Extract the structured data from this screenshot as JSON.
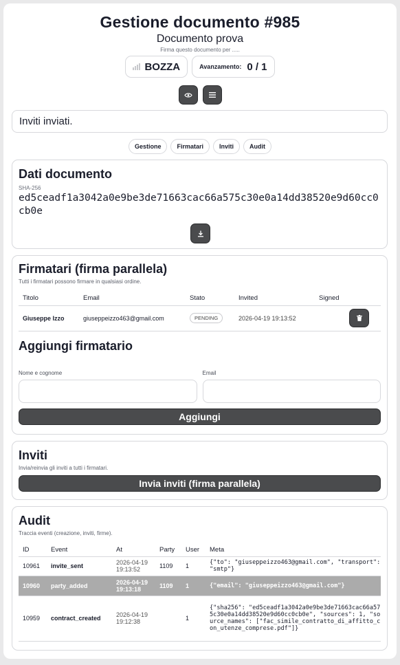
{
  "header": {
    "title": "Gestione documento #985",
    "subtitle": "Documento prova",
    "hint": "Firma questo documento per ....."
  },
  "status": {
    "state": "BOZZA",
    "progress_label": "Avanzamento:",
    "progress_value": "0 / 1",
    "progress_fraction": 0
  },
  "flash": "Inviti inviati.",
  "tabs": [
    "Gestione",
    "Firmatari",
    "Inviti",
    "Audit"
  ],
  "document": {
    "heading": "Dati documento",
    "sha_label": "SHA-256",
    "sha": "ed5ceadf1a3042a0e9be3de71663cac66a575c30e0a14dd38520e9d60cc0cb0e"
  },
  "signers": {
    "heading": "Firmatari (firma parallela)",
    "desc": "Tutti i firmatari possono firmare in qualsiasi ordine.",
    "columns": [
      "Titolo",
      "Email",
      "Stato",
      "Invited",
      "Signed"
    ],
    "rows": [
      {
        "name": "Giuseppe Izzo",
        "email": "giuseppeizzo463@gmail.com",
        "status": "PENDING",
        "invited": "2026-04-19 19:13:52",
        "signed": ""
      }
    ]
  },
  "add_signer": {
    "heading": "Aggiungi firmatario",
    "name_label": "Nome e cognome",
    "email_label": "Email",
    "button": "Aggiungi"
  },
  "invites": {
    "heading": "Inviti",
    "desc": "Invia/reinvia gli inviti a tutti i firmatari.",
    "button": "Invia inviti (firma parallela)"
  },
  "audit": {
    "heading": "Audit",
    "desc": "Traccia eventi (creazione, inviti, firme).",
    "columns": [
      "ID",
      "Event",
      "At",
      "Party",
      "User",
      "Meta"
    ],
    "rows": [
      {
        "id": "10961",
        "event": "invite_sent",
        "at": "2026-04-19 19:13:52",
        "party": "1109",
        "user": "1",
        "meta": "{\"to\": \"giuseppeizzo463@gmail.com\", \"transport\": \"smtp\"}"
      },
      {
        "id": "10960",
        "event": "party_added",
        "at": "2026-04-19 19:13:18",
        "party": "1109",
        "user": "1",
        "meta": "{\"email\": \"giuseppeizzo463@gmail.com\"}"
      },
      {
        "id": "10959",
        "event": "contract_created",
        "at": "2026-04-19 19:12:38",
        "party": "",
        "user": "1",
        "meta": "{\"sha256\": \"ed5ceadf1a3042a0e9be3de71663cac66a575c30e0a14dd38520e9d60cc0cb0e\", \"sources\": 1, \"source_names\": [\"fac_simile_contratto_di_affitto_con_utenze_comprese.pdf\"]}"
      }
    ]
  },
  "icons": {
    "preview": "eye-icon",
    "menu": "menu-icon",
    "download": "download-icon",
    "delete": "trash-icon",
    "status": "signal-bars-icon"
  },
  "colors": {
    "button_dark": "#4a4b4d",
    "highlight_row": "#ababab",
    "border": "#d7d8dc"
  }
}
